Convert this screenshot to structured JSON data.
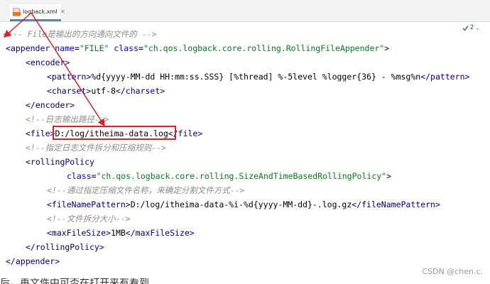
{
  "tab": {
    "label": "logback.xml",
    "icon": "xml-file-icon",
    "close": "×",
    "accent": "#4a88c7"
  },
  "inspection": {
    "count": "2",
    "icon": "check-icon",
    "chevron": "⌄"
  },
  "code": {
    "l1_comment": "<!-- File是输出的方向通向文件的 -->",
    "l2_open": "<",
    "l2_tag": "appender",
    "l2_attr1": "name",
    "l2_eq1": "=",
    "l2_val1": "\"FILE\"",
    "l2_attr2": "class",
    "l2_eq2": "=",
    "l2_val2": "\"ch.qos.logback.core.rolling.RollingFileAppender\"",
    "l2_close": ">",
    "l3_tag": "<encoder>",
    "l4_open": "<pattern>",
    "l4_text": "%d{yyyy-MM-dd HH:mm:ss.SSS} [%thread] %-5level %logger{36} - %msg%n",
    "l4_close": "</pattern>",
    "l5_open": "<charset>",
    "l5_text": "utf-8",
    "l5_close": "</charset>",
    "l6_tag": "</encoder>",
    "l7_comment": "<!--日志输出路径-->",
    "l8_open": "<file>",
    "l8_text": "D:/log/itheima-data.log",
    "l8_close": "</file>",
    "l9_comment": "<!--指定日志文件拆分和压缩规则-->",
    "l10_tag": "<rollingPolicy",
    "l11_attr": "class",
    "l11_eq": "=",
    "l11_val": "\"ch.qos.logback.core.rolling.SizeAndTimeBasedRollingPolicy\"",
    "l11_close": ">",
    "l12_comment": "<!--通过指定压缩文件名称，来确定分割文件方式-->",
    "l13_open": "<fileNamePattern>",
    "l13_text": "D:/log/itheima-data-%i-%d{yyyy-MM-dd}-.log.gz",
    "l13_close": "</fileNamePattern>",
    "l14_comment": "<!--文件拆分大小-->",
    "l15_open": "<maxFileSize>",
    "l15_text": "1MB",
    "l15_close": "</maxFileSize>",
    "l16_tag": "</rollingPolicy>",
    "l17_tag": "</appender>"
  },
  "colors": {
    "tag": "#000080",
    "attr": "#0000ff",
    "value": "#067d17",
    "comment": "#8c8c8c",
    "annotation": "#e02020"
  },
  "watermark": "CSDN @chen.c.",
  "partial_text": "后，再文件中可否在打开来有看到……"
}
